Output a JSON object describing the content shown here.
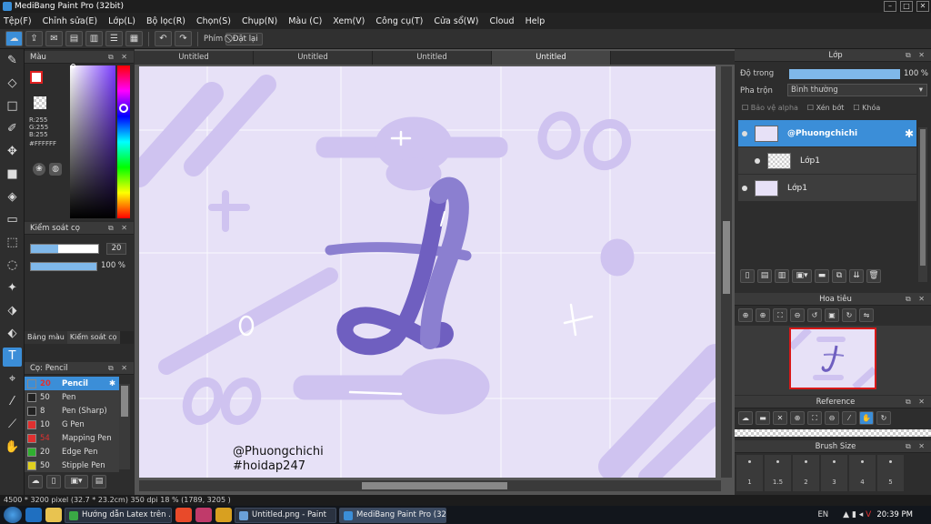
{
  "title": "MediBang Paint Pro (32bit)",
  "menu": [
    "Tệp(F)",
    "Chỉnh sửa(E)",
    "Lớp(L)",
    "Bộ lọc(R)",
    "Chọn(S)",
    "Chụp(N)",
    "Màu (C)",
    "Xem(V)",
    "Công cụ(T)",
    "Cửa sổ(W)",
    "Cloud",
    "Help"
  ],
  "toolbar": {
    "label": "Phím",
    "reset": "Đặt lại"
  },
  "tabs": [
    "Untitled",
    "Untitled",
    "Untitled",
    "Untitled"
  ],
  "color_panel": {
    "title": "Màu",
    "r": "R:255",
    "g": "G:255",
    "b": "B:255",
    "hex": "#FFFFFF"
  },
  "brush_control": {
    "title": "Kiểm soát cọ",
    "size": "20",
    "opacity": "100 %",
    "tab1": "Bảng màu",
    "tab2": "Kiểm soát cọ"
  },
  "brush_panel": {
    "title": "Cọ: Pencil",
    "items": [
      {
        "size": "20",
        "name": "Pencil",
        "color": "#3b8ed8",
        "selected": true
      },
      {
        "size": "50",
        "name": "Pen",
        "color": "#222222",
        "selected": false
      },
      {
        "size": "8",
        "name": "Pen (Sharp)",
        "color": "#222222",
        "selected": false
      },
      {
        "size": "10",
        "name": "G Pen",
        "color": "#e03030",
        "selected": false
      },
      {
        "size": "54",
        "name": "Mapping Pen",
        "color": "#e03030",
        "selected": false
      },
      {
        "size": "20",
        "name": "Edge Pen",
        "color": "#30b030",
        "selected": false
      },
      {
        "size": "50",
        "name": "Stipple Pen",
        "color": "#e0d020",
        "selected": false
      }
    ]
  },
  "layer_panel": {
    "title": "Lớp",
    "opacity_label": "Độ trong",
    "opacity_value": "100 %",
    "blend_label": "Pha trộn",
    "blend_value": "Bình thường",
    "protect_alpha": "Bảo vệ alpha",
    "clip": "Xén bớt",
    "lock": "Khóa",
    "layers": [
      {
        "name": "@Phuongchichi",
        "selected": true
      },
      {
        "name": "Lớp1",
        "selected": false
      },
      {
        "name": "Lớp1",
        "selected": false
      }
    ]
  },
  "navigator": {
    "title": "Hoa tiêu"
  },
  "reference": {
    "title": "Reference"
  },
  "brush_size": {
    "title": "Brush Size",
    "values": [
      "1",
      "1.5",
      "2",
      "3",
      "4",
      "5"
    ]
  },
  "canvas_text": {
    "line1": "@Phuongchichi",
    "line2": "#hoidap247"
  },
  "status": "4500 * 3200 pixel   (32.7 * 23.2cm)  350 dpi   18 %   (1789, 3205 )",
  "taskbar": {
    "items": [
      "Hướng dẫn Latex trên ...",
      "Untitled.png - Paint",
      "MediBang Paint Pro (32..."
    ],
    "lang": "EN",
    "time": "20:39 PM"
  }
}
